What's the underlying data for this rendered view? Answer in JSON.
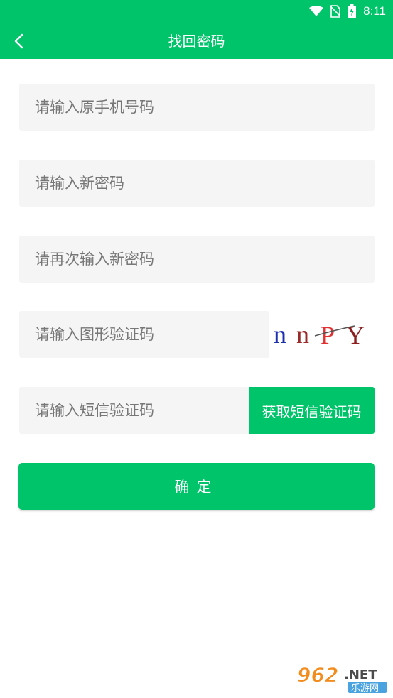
{
  "status_bar": {
    "time": "8:11",
    "icons": [
      "wifi-icon",
      "no-sim-icon",
      "battery-charging-icon"
    ]
  },
  "header": {
    "title": "找回密码",
    "back_icon": "chevron-left-icon"
  },
  "form": {
    "phone_placeholder": "请输入原手机号码",
    "new_password_placeholder": "请输入新密码",
    "confirm_password_placeholder": "请再次输入新密码",
    "captcha_placeholder": "请输入图形验证码",
    "captcha_text": [
      "n",
      "n",
      "P",
      "Y"
    ],
    "sms_placeholder": "请输入短信验证码",
    "sms_button_label": "获取短信验证码",
    "confirm_button_label": "确定"
  },
  "watermark": {
    "number": "962",
    "domain": ".NET",
    "site": "乐游网"
  },
  "colors": {
    "primary": "#00c46a",
    "field_bg": "#f5f5f5",
    "placeholder": "#777777"
  }
}
